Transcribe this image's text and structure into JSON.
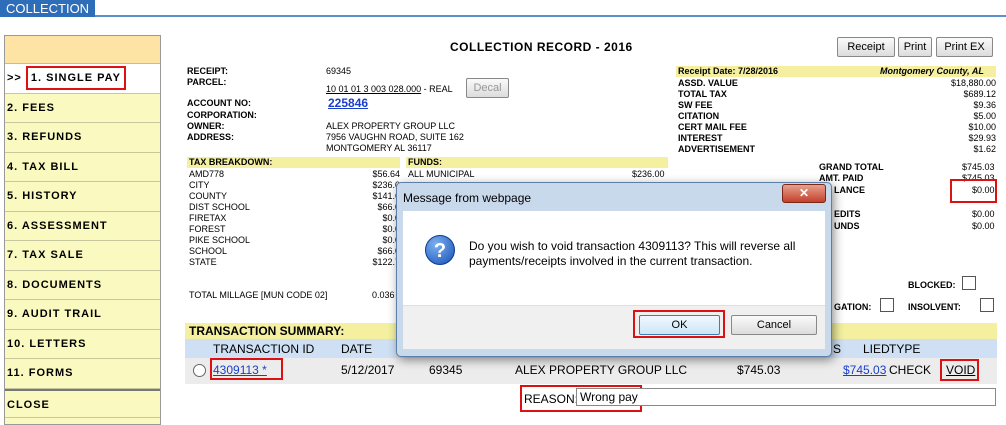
{
  "app": {
    "tab": "COLLECTION"
  },
  "sidebar": {
    "items": [
      {
        "marker": ">>",
        "label": "1. SINGLE PAY"
      },
      {
        "label": "2. FEES"
      },
      {
        "label": "3. REFUNDS"
      },
      {
        "label": "4. TAX BILL"
      },
      {
        "label": "5. HISTORY"
      },
      {
        "label": "6. ASSESSMENT"
      },
      {
        "label": "7. TAX SALE"
      },
      {
        "label": "8. DOCUMENTS"
      },
      {
        "label": "9. AUDIT TRAIL"
      },
      {
        "label": "10. LETTERS"
      },
      {
        "label": "11. FORMS"
      },
      {
        "label": "CLOSE"
      }
    ]
  },
  "header": {
    "title": "COLLECTION RECORD - 2016",
    "receipt_btn": "Receipt",
    "print_btn": "Print",
    "printex_btn": "Print EX"
  },
  "record": {
    "receipt_label": "RECEIPT:",
    "receipt_value": "69345",
    "parcel_label": "PARCEL:",
    "parcel_value": "10 01 01 3 003 028.000",
    "parcel_type": "- REAL",
    "decal_btn": "Decal",
    "account_label": "ACCOUNT NO:",
    "account_value": "225846",
    "corporation_label": "CORPORATION:",
    "owner_label": "OWNER:",
    "owner_value": "ALEX PROPERTY GROUP LLC",
    "address_label": "ADDRESS:",
    "address_line1": "7956 VAUGHN ROAD, SUITE 162",
    "address_line2": "MONTGOMERY AL  36117"
  },
  "tax_breakdown": {
    "header": "TAX BREAKDOWN:",
    "rows": [
      {
        "name": "AMD778",
        "value": "$56.64"
      },
      {
        "name": "CITY",
        "value": "$236.0"
      },
      {
        "name": "COUNTY",
        "value": "$141.6"
      },
      {
        "name": "DIST SCHOOL",
        "value": "$66.0"
      },
      {
        "name": "FIRETAX",
        "value": "$0.0"
      },
      {
        "name": "FOREST",
        "value": "$0.0"
      },
      {
        "name": "PIKE SCHOOL",
        "value": "$0.0"
      },
      {
        "name": "SCHOOL",
        "value": "$66.0"
      },
      {
        "name": "STATE",
        "value": "$122.7"
      }
    ],
    "millage_label": "TOTAL MILLAGE [MUN CODE 02]",
    "millage_value": "0.036"
  },
  "funds": {
    "header": "FUNDS:",
    "rows": [
      {
        "name": "ALL MUNICIPAL",
        "value": "$236.00"
      }
    ]
  },
  "summary": {
    "receipt_date": "Receipt Date: 7/28/2016",
    "county": "Montgomery County, AL",
    "rows": [
      {
        "name": "ASSD. VALUE",
        "value": "$18,880.00"
      },
      {
        "name": "TOTAL TAX",
        "value": "$689.12"
      },
      {
        "name": "SW FEE",
        "value": "$9.36"
      },
      {
        "name": "CITATION",
        "value": "$5.00"
      },
      {
        "name": "CERT MAIL FEE",
        "value": "$10.00"
      },
      {
        "name": "INTEREST",
        "value": "$29.93"
      },
      {
        "name": "ADVERTISEMENT",
        "value": "$1.62"
      }
    ],
    "grand_total_label": "GRAND TOTAL",
    "grand_total_value": "$745.03",
    "amt_paid_label": "AMT. PAID",
    "amt_paid_value": "$745.03",
    "balance_label": "LANCE",
    "balance_value": "$0.00",
    "credits_label": "EDITS",
    "credits_value": "$0.00",
    "refunds_label": "UNDS",
    "refunds_value": "$0.00",
    "blocked_label": "BLOCKED:",
    "litigation_label": "GATION:",
    "insolvent_label": "INSOLVENT:"
  },
  "transactions": {
    "header": "TRANSACTION SUMMARY:",
    "columns": {
      "id": "TRANSACTION ID",
      "date": "DATE",
      "applied": "LIED",
      "type": "TYPE",
      "seg": "S"
    },
    "row": {
      "id": "4309113  *",
      "date": "5/12/2017",
      "receipt": "69345",
      "owner": "ALEX PROPERTY GROUP LLC",
      "amount": "$745.03",
      "applied": "$745.03",
      "type": "CHECK",
      "action": "VOID"
    },
    "reason_label": "REASON:",
    "reason_value": "Wrong pay"
  },
  "dialog": {
    "title": "Message from webpage",
    "close": "✕",
    "message": "Do you wish to void transaction 4309113? This will reverse all payments/receipts involved in the current transaction.",
    "ok": "OK",
    "cancel": "Cancel"
  }
}
